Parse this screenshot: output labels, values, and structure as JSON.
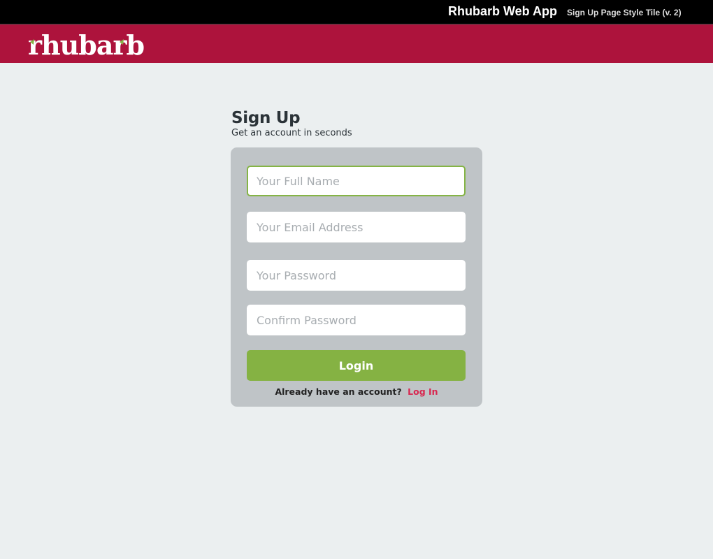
{
  "topbar": {
    "app_title": "Rhubarb Web App",
    "tile_label": "Sign Up Page Style Tile (v. 2)"
  },
  "brand": {
    "logo_text": "rhubarb",
    "bar_color": "#ad133c",
    "leaf_color": "#85b446"
  },
  "signup": {
    "title": "Sign Up",
    "subtitle": "Get an account in seconds",
    "fields": {
      "full_name_placeholder": "Your Full Name",
      "email_placeholder": "Your Email Address",
      "password_placeholder": "Your Password",
      "confirm_placeholder": "Confirm Password"
    },
    "submit_label": "Login",
    "footer_text": "Already have an account?",
    "login_link": "Log In"
  },
  "colors": {
    "accent_green": "#85b243",
    "link_pink": "#d8264f",
    "card_gray": "#bfc4c7",
    "page_bg": "#ebeff0"
  }
}
